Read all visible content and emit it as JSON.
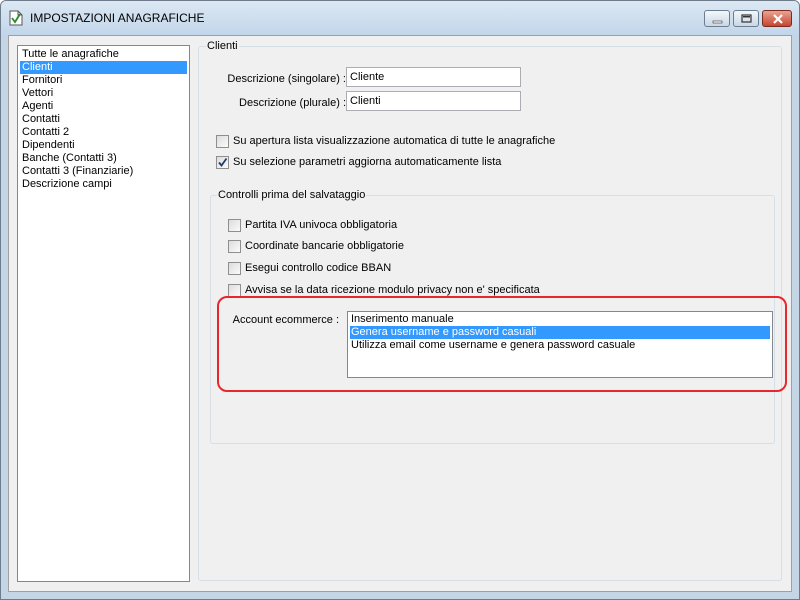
{
  "window": {
    "title": "IMPOSTAZIONI ANAGRAFICHE",
    "icon": "app-document-icon",
    "controls": [
      "minimize-icon",
      "maximize-icon",
      "close-icon"
    ]
  },
  "sidebar": {
    "items": [
      {
        "label": "Tutte le anagrafiche",
        "selected": false
      },
      {
        "label": "Clienti",
        "selected": true
      },
      {
        "label": "Fornitori",
        "selected": false
      },
      {
        "label": "Vettori",
        "selected": false
      },
      {
        "label": "Agenti",
        "selected": false
      },
      {
        "label": "Contatti",
        "selected": false
      },
      {
        "label": "Contatti 2",
        "selected": false
      },
      {
        "label": "Dipendenti",
        "selected": false
      },
      {
        "label": "Banche (Contatti 3)",
        "selected": false
      },
      {
        "label": "Contatti 3 (Finanziarie)",
        "selected": false
      },
      {
        "label": "Descrizione campi",
        "selected": false
      }
    ]
  },
  "clienti": {
    "group_title": "Clienti",
    "desc_singolare_label": "Descrizione (singolare) :",
    "desc_singolare_value": "Cliente",
    "desc_plurale_label": "Descrizione (plurale) :",
    "desc_plurale_value": "Clienti",
    "options": [
      {
        "label": "Su apertura lista visualizzazione automatica di tutte le anagrafiche",
        "checked": false
      },
      {
        "label": "Su selezione parametri aggiorna automaticamente lista",
        "checked": true
      }
    ]
  },
  "controlli": {
    "group_title": "Controlli prima del salvataggio",
    "options": [
      {
        "label": "Partita IVA univoca obbligatoria",
        "checked": false
      },
      {
        "label": "Coordinate bancarie obbligatorie",
        "checked": false
      },
      {
        "label": "Esegui controllo codice BBAN",
        "checked": false
      },
      {
        "label": "Avvisa se la data ricezione modulo privacy non e' specificata",
        "checked": false
      }
    ]
  },
  "ecommerce": {
    "label": "Account ecommerce :",
    "options": [
      {
        "label": "Inserimento manuale",
        "selected": false
      },
      {
        "label": "Genera username e password casuali",
        "selected": true
      },
      {
        "label": "Utilizza email come username e genera password casuale",
        "selected": false
      }
    ]
  },
  "colors": {
    "selection": "#3399ff",
    "highlight_border": "#e8262d",
    "window_frame": "#c4d5e6"
  }
}
